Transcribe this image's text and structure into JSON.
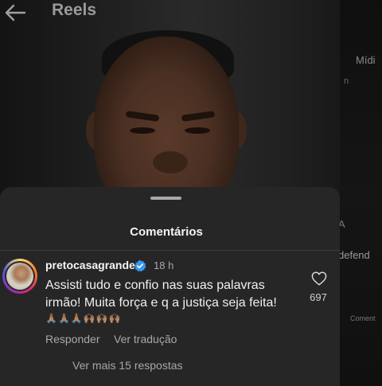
{
  "header": {
    "title": "Reels"
  },
  "background_peek": {
    "right_top": "Mídi",
    "right_sub": "n",
    "right_mid": "A",
    "right_defend": "defend",
    "right_comments": "Coment"
  },
  "comments_sheet": {
    "title": "Comentários",
    "comment": {
      "username": "pretocasagrande",
      "time": "18 h",
      "text": "Assisti tudo e confio nas suas palavras irmão! Muita força e q a justiça seja feita!",
      "emojis": "🙏🏽🙏🏽🙏🏽🙌🏽🙌🏽🙌🏽",
      "likes": "697",
      "reply_label": "Responder",
      "translate_label": "Ver tradução",
      "more_replies_label": "Ver mais 15 respostas"
    }
  },
  "colors": {
    "sheet_bg": "#262626",
    "verified_blue": "#3897f0",
    "secondary_text": "#a8a8a8"
  }
}
